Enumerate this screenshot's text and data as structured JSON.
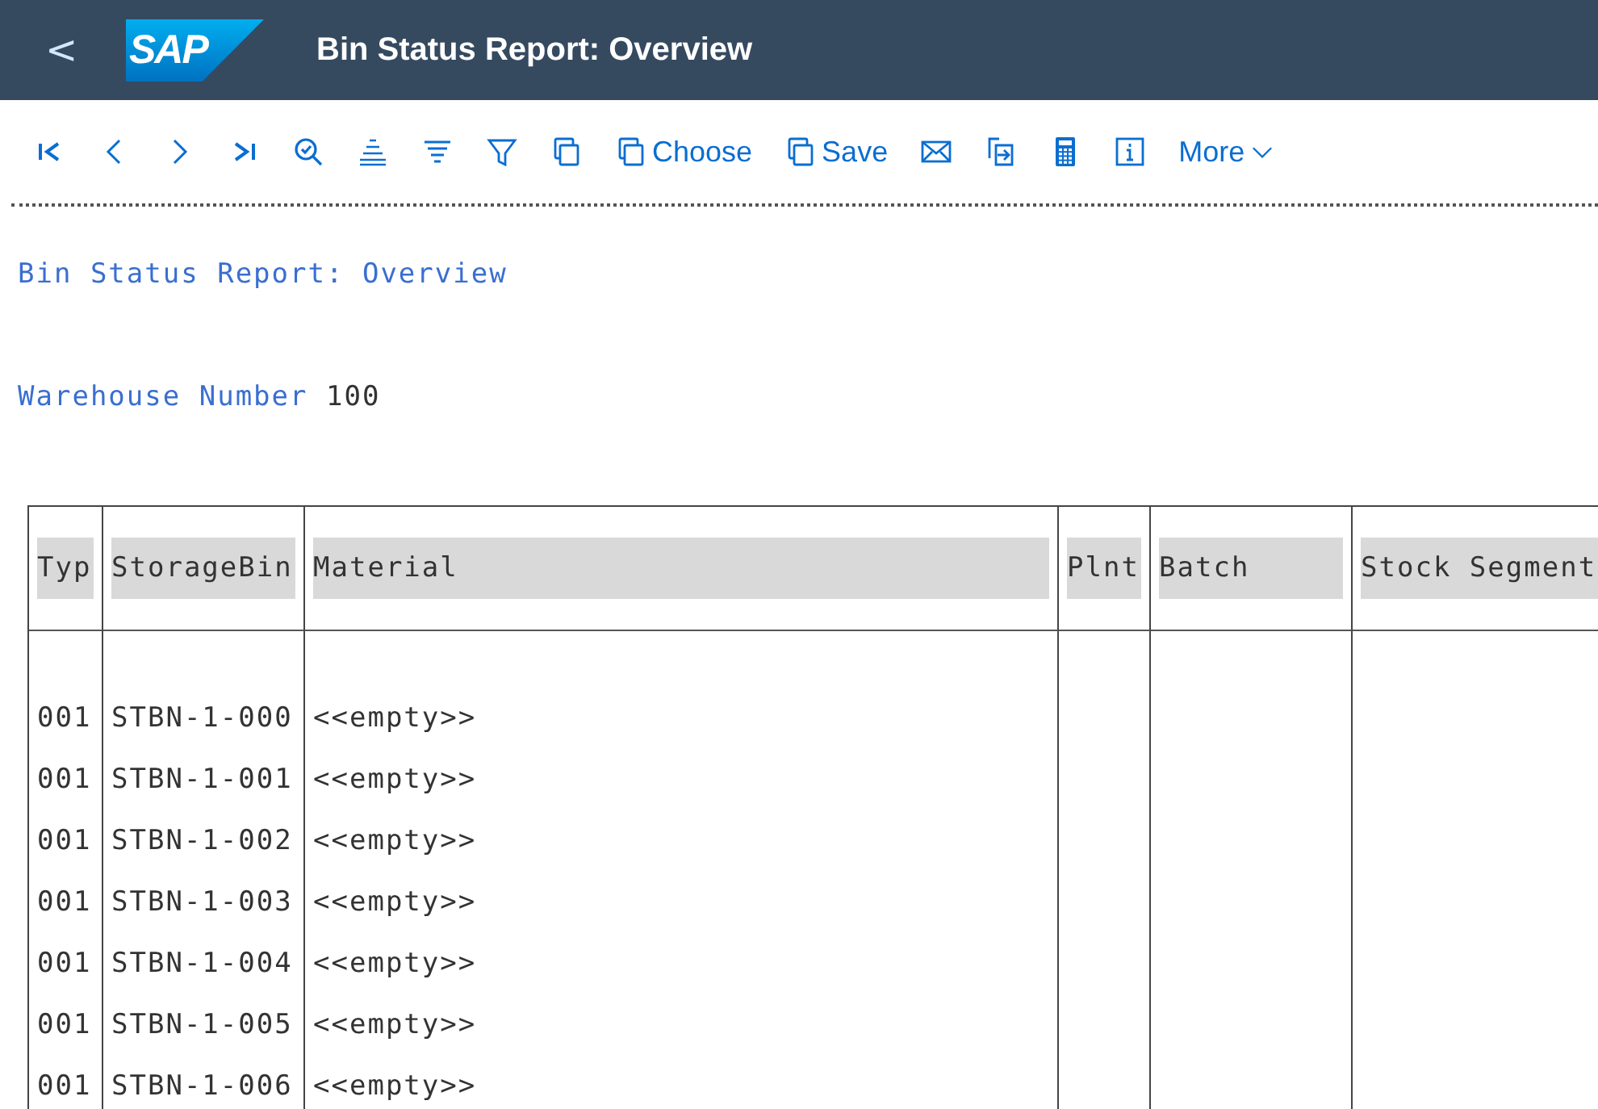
{
  "shell": {
    "back": "<",
    "logo": "SAP",
    "title": "Bin Status Report: Overview"
  },
  "toolbar": [
    {
      "kind": "first"
    },
    {
      "kind": "prev"
    },
    {
      "kind": "next"
    },
    {
      "kind": "last"
    },
    {
      "kind": "find"
    },
    {
      "kind": "sort-up"
    },
    {
      "kind": "sort-down"
    },
    {
      "kind": "filter"
    },
    {
      "kind": "copy"
    },
    {
      "kind": "copy",
      "label": "Choose"
    },
    {
      "kind": "copy",
      "label": "Save"
    },
    {
      "kind": "mail"
    },
    {
      "kind": "export"
    },
    {
      "kind": "calc"
    },
    {
      "kind": "info"
    },
    {
      "kind": "menu",
      "label": "More"
    }
  ],
  "report": {
    "heading": "Bin Status Report: Overview",
    "field_label": "Warehouse Number",
    "field_value": "100"
  },
  "table": {
    "columns": [
      "Typ",
      "StorageBin",
      "Material",
      "Plnt",
      "Batch",
      "Stock Segment"
    ],
    "rows": [
      [
        "001",
        "STBN-1-000",
        "<<empty>>",
        "",
        "",
        ""
      ],
      [
        "001",
        "STBN-1-001",
        "<<empty>>",
        "",
        "",
        ""
      ],
      [
        "001",
        "STBN-1-002",
        "<<empty>>",
        "",
        "",
        ""
      ],
      [
        "001",
        "STBN-1-003",
        "<<empty>>",
        "",
        "",
        ""
      ],
      [
        "001",
        "STBN-1-004",
        "<<empty>>",
        "",
        "",
        ""
      ],
      [
        "001",
        "STBN-1-005",
        "<<empty>>",
        "",
        "",
        ""
      ],
      [
        "001",
        "STBN-1-006",
        "<<empty>>",
        "",
        "",
        ""
      ]
    ]
  }
}
